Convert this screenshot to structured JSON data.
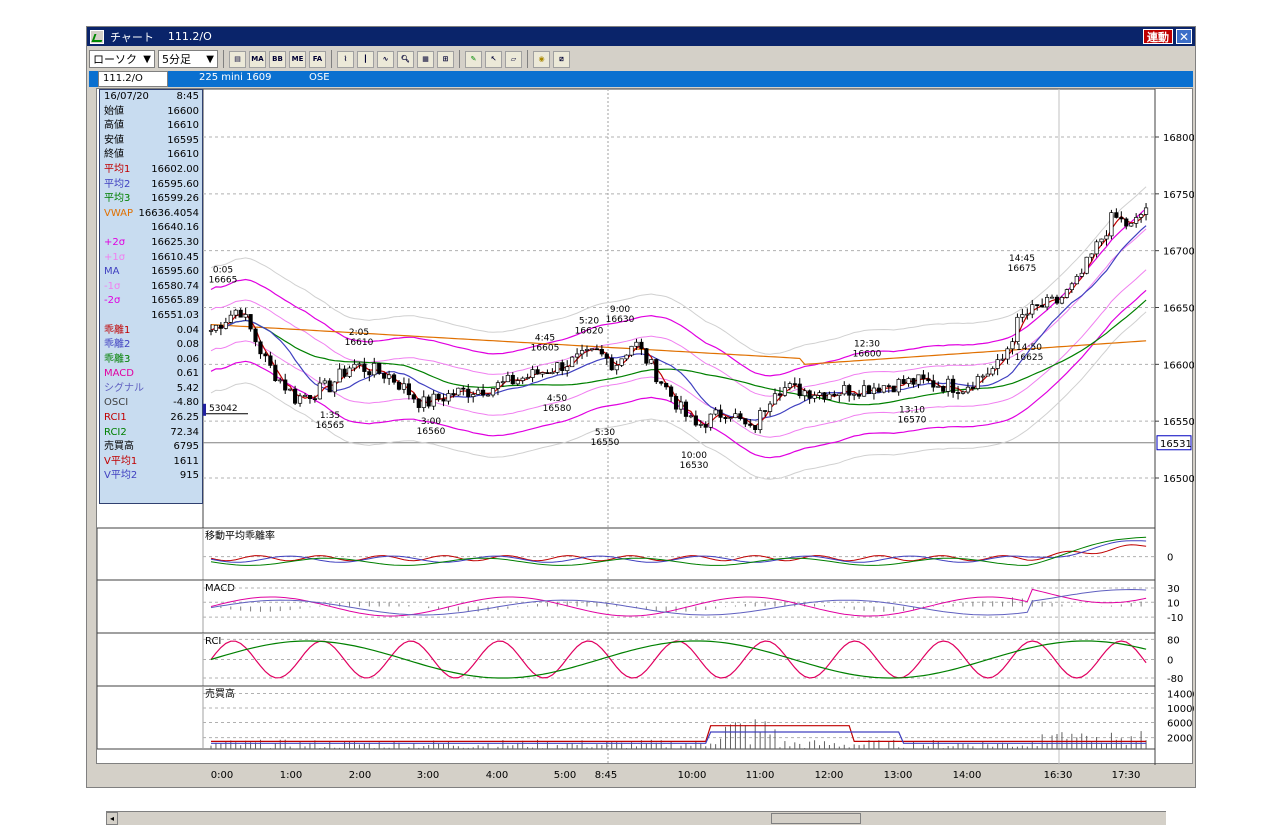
{
  "window": {
    "title": "チャート",
    "symbol_code": "111.2/O",
    "link_button": "連動",
    "close_label": "✕"
  },
  "toolbar": {
    "chart_type": "ローソク",
    "interval": "5分足",
    "buttons": [
      "new-chart",
      "MA",
      "BB",
      "MIE",
      "FA",
      "line",
      "candle",
      "zoom",
      "search",
      "settings",
      "table",
      "pen",
      "cursor",
      "eraser",
      "find",
      "print"
    ]
  },
  "symbol_bar": {
    "code": "111.2/O",
    "description": "225 mini 1609",
    "exchange": "OSE"
  },
  "info_panel": {
    "date": "16/07/20",
    "time": "8:45",
    "rows": [
      {
        "label": "始値",
        "value": "16600",
        "color": "#000000"
      },
      {
        "label": "高値",
        "value": "16610",
        "color": "#000000"
      },
      {
        "label": "安値",
        "value": "16595",
        "color": "#000000"
      },
      {
        "label": "終値",
        "value": "16610",
        "color": "#000000"
      },
      {
        "label": "平均1",
        "value": "16602.00",
        "color": "#c00000"
      },
      {
        "label": "平均2",
        "value": "16595.60",
        "color": "#4040c0"
      },
      {
        "label": "平均3",
        "value": "16599.26",
        "color": "#008000"
      },
      {
        "label": "VWAP",
        "value": "16636.4054",
        "color": "#e07000"
      },
      {
        "label": "",
        "value": "16640.16",
        "color": "#000000"
      },
      {
        "label": "+2σ",
        "value": "16625.30",
        "color": "#e000e0"
      },
      {
        "label": "+1σ",
        "value": "16610.45",
        "color": "#f080f0"
      },
      {
        "label": "MA",
        "value": "16595.60",
        "color": "#4040c0"
      },
      {
        "label": "-1σ",
        "value": "16580.74",
        "color": "#f080f0"
      },
      {
        "label": "-2σ",
        "value": "16565.89",
        "color": "#e000e0"
      },
      {
        "label": "",
        "value": "16551.03",
        "color": "#000000"
      },
      {
        "label": "乖離1",
        "value": "0.04",
        "color": "#c00000"
      },
      {
        "label": "乖離2",
        "value": "0.08",
        "color": "#4040c0"
      },
      {
        "label": "乖離3",
        "value": "0.06",
        "color": "#008000"
      },
      {
        "label": "MACD",
        "value": "0.61",
        "color": "#e000a0"
      },
      {
        "label": "シグナル",
        "value": "5.42",
        "color": "#6060c0"
      },
      {
        "label": "OSCI",
        "value": "-4.80",
        "color": "#404040"
      },
      {
        "label": "RCI1",
        "value": "26.25",
        "color": "#c00000"
      },
      {
        "label": "RCI2",
        "value": "72.34",
        "color": "#008000"
      },
      {
        "label": "売買高",
        "value": "6795",
        "color": "#000000"
      },
      {
        "label": "V平均1",
        "value": "1611",
        "color": "#c00000"
      },
      {
        "label": "V平均2",
        "value": "915",
        "color": "#4040c0"
      }
    ]
  },
  "price_axis": {
    "ticks": [
      "16800",
      "16750",
      "16700",
      "16650",
      "16600",
      "16550",
      "16500"
    ],
    "current": "16531",
    "marker": "53042"
  },
  "annotations": [
    {
      "time": "0:05",
      "price": "16665"
    },
    {
      "time": "1:35",
      "price": "16565"
    },
    {
      "time": "2:05",
      "price": "16610"
    },
    {
      "time": "3:00",
      "price": "16560"
    },
    {
      "time": "4:45",
      "price": "16605"
    },
    {
      "time": "4:50",
      "price": "16580"
    },
    {
      "time": "5:20",
      "price": "16620"
    },
    {
      "time": "5:30",
      "price": "16550"
    },
    {
      "time": "9:00",
      "price": "16630"
    },
    {
      "time": "10:00",
      "price": "16530"
    },
    {
      "time": "12:30",
      "price": "16600"
    },
    {
      "time": "13:10",
      "price": "16570"
    },
    {
      "time": "14:45",
      "price": "16675"
    },
    {
      "time": "14:50",
      "price": "16625"
    }
  ],
  "panes": [
    {
      "title": "移動平均乖離率",
      "ticks": [
        "0"
      ]
    },
    {
      "title": "MACD",
      "ticks": [
        "30",
        "10",
        "-10"
      ]
    },
    {
      "title": "RCI",
      "ticks": [
        "80",
        "0",
        "-80"
      ]
    },
    {
      "title": "売買高",
      "ticks": [
        "14000",
        "10000",
        "6000",
        "2000"
      ]
    }
  ],
  "time_axis": [
    "0:00",
    "1:00",
    "2:00",
    "3:00",
    "4:00",
    "5:00",
    "8:45",
    "10:00",
    "11:00",
    "12:00",
    "13:00",
    "14:00",
    "16:30",
    "17:30"
  ],
  "colors": {
    "title_bar": "#0a246a",
    "symbol_bar": "#0a70d0",
    "info_panel": "#c8dcf0",
    "ma1": "#c00000",
    "ma2": "#4040c0",
    "ma3": "#008000",
    "vwap": "#e07000",
    "bb2": "#e000e0",
    "bb1": "#f080f0"
  }
}
